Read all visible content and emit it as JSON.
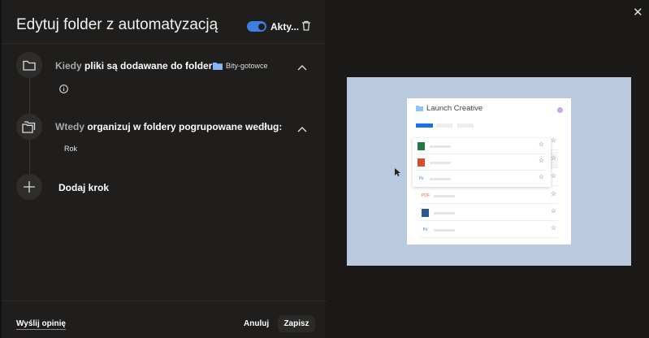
{
  "dialog": {
    "title": "Edytuj folder z automatyzacją",
    "active_label": "Akty...",
    "active": true
  },
  "trigger": {
    "prefix": "Kiedy",
    "text": "pliki są dodawane do folderu",
    "folder": "Bity-gotowce"
  },
  "action": {
    "prefix": "Wtedy",
    "text": "organizuj w foldery pogrupowane według:",
    "group": "Rok"
  },
  "add_step": "Dodaj krok",
  "footer": {
    "feedback": "Wyślij opinię",
    "cancel": "Anuluj",
    "save": "Zapisz"
  },
  "preview": {
    "title": "Launch Creative"
  },
  "colors": {
    "accent": "#3d7fe0",
    "preview_bg": "#b8c9e0"
  }
}
